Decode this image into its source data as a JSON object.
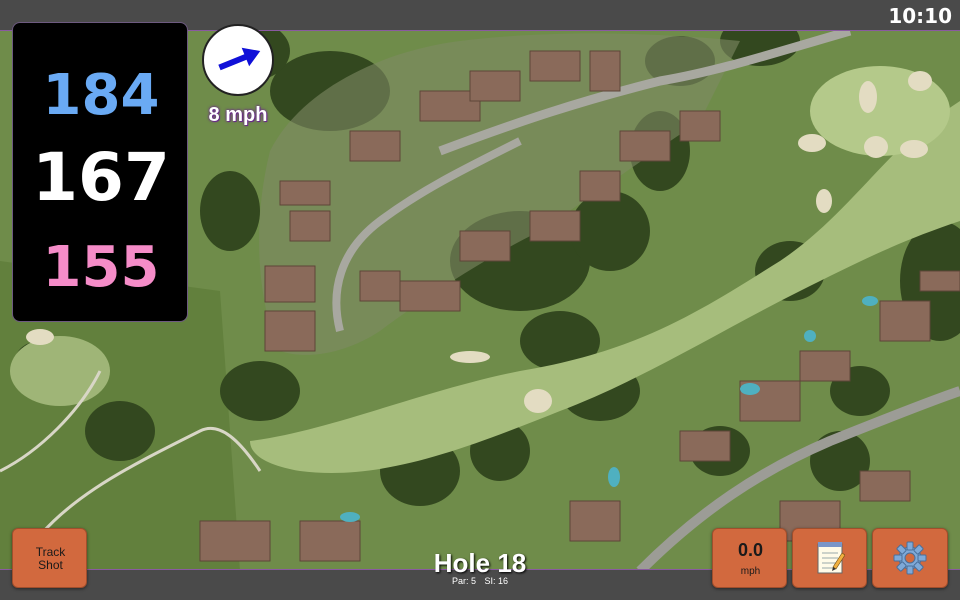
{
  "status": {
    "time": "10:10"
  },
  "distances": {
    "back": "184",
    "middle": "167",
    "front": "155"
  },
  "wind": {
    "speed_label": "8 mph",
    "arrow_icon": "arrow-right-icon"
  },
  "hole": {
    "title": "Hole 18",
    "par": "Par: 5",
    "si": "SI: 16"
  },
  "buttons": {
    "track_shot": "Track\nShot",
    "speed_value": "0.0",
    "speed_unit": "mph",
    "notes_icon": "notepad-icon",
    "settings_icon": "gear-icon"
  },
  "colors": {
    "back": "#6aaaf4",
    "middle": "#ffffff",
    "front": "#f58cc8",
    "button": "#d2693e",
    "bar": "#4a4a4a"
  }
}
